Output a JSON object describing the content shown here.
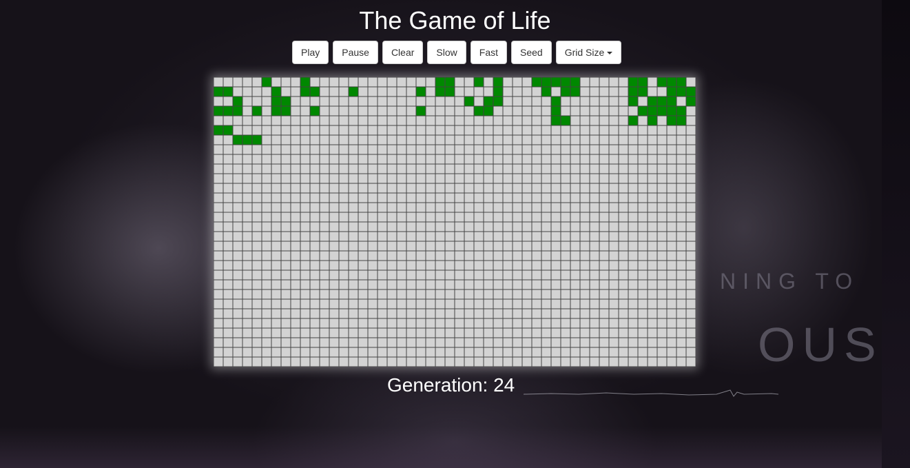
{
  "app": {
    "title": "The Game of Life"
  },
  "toolbar": {
    "play": "Play",
    "pause": "Pause",
    "clear": "Clear",
    "slow": "Slow",
    "fast": "Fast",
    "seed": "Seed",
    "grid_size": "Grid Size"
  },
  "board": {
    "cols": 50,
    "rows": 30,
    "colors": {
      "alive": "#008800",
      "dead": "#d3d3d3",
      "line": "#444444"
    },
    "cells": [
      "00000100010000000000000110010100011111000001101110",
      "11000010011000100000010110000100001011000001100111",
      "00100011000000000000000000101100000100000001011101",
      "11101011001000000000010000011000000100000000111110",
      "00000000000000000000000000000000000110000001010110",
      "11000000000000000000000000000000000000000000000000",
      "00111000000000000000000000000000000000000000000000",
      "00000000000000000000000000000000000000000000000000",
      "00000000000000000000000000000000000000000000000000",
      "00000000000000000000000000000000000000000000000000",
      "00000000000000000000000000000000000000000000000000",
      "00000000000000000000000000000000000000000000000000",
      "00000000000000000000000000000000000000000000000000",
      "00000000000000000000000000000000000000000000000000",
      "00000000000000000000000000000000000000000000000000",
      "00000000000000000000000000000000000000000000000000",
      "00000000000000000000000000000000000000000000000000",
      "00000000000000000000000000000000000000000000000000",
      "00000000000000000000000000000000000000000000000000",
      "00000000000000000000000000000000000000000000000000",
      "00000000000000000000000000000000000000000000000000",
      "00000000000000000000000000000000000000000000000000",
      "00000000000000000000000000000000000000000000000000",
      "00000000000000000000000000000000000000000000000000",
      "00000000000000000000000000000000000000000000000000",
      "00000000000000000000000000000000000000000000000000",
      "00000000000000000000000000000000000000000000000000",
      "00000000000000000000000000000000000000000000000000",
      "00000000000000000000000000000000000000000000000000",
      "00000000000000000000000000000000000000000000000000"
    ]
  },
  "status": {
    "generation": "Generation: 24"
  },
  "background": {
    "art_text_1": "NING TO",
    "art_text_2": "OUS"
  }
}
